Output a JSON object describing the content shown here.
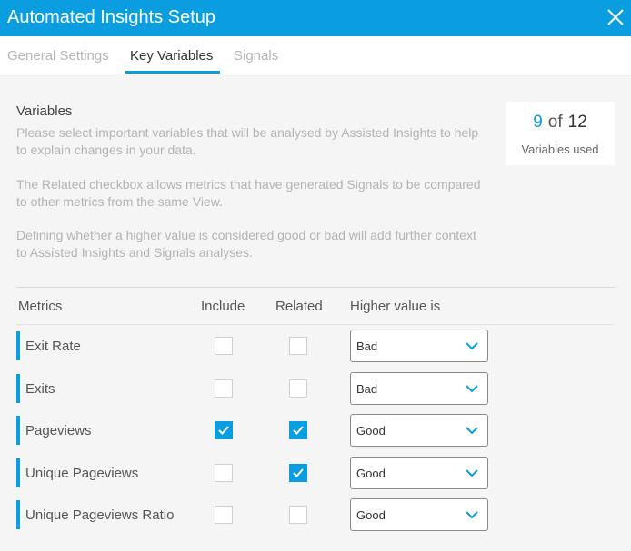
{
  "window": {
    "title": "Automated Insights Setup"
  },
  "tabs": [
    {
      "label": "General Settings",
      "active": false
    },
    {
      "label": "Key Variables",
      "active": true
    },
    {
      "label": "Signals",
      "active": false
    }
  ],
  "variables": {
    "heading": "Variables",
    "para1": "Please select important variables that will be analysed by Assisted Insights to help to explain changes in your data.",
    "para2": "The Related checkbox allows metrics that have generated Signals to be compared to other metrics from the same View.",
    "para3": "Defining whether a higher value is considered good or bad will add further context to Assisted Insights and Signals analyses."
  },
  "counter": {
    "used": "9",
    "of": "of",
    "total": "12",
    "label": "Variables used"
  },
  "table": {
    "headers": {
      "metrics": "Metrics",
      "include": "Include",
      "related": "Related",
      "higher": "Higher value is"
    },
    "rows": [
      {
        "metric": "Exit Rate",
        "include": false,
        "related": false,
        "higher": "Bad"
      },
      {
        "metric": "Exits",
        "include": false,
        "related": false,
        "higher": "Bad"
      },
      {
        "metric": "Pageviews",
        "include": true,
        "related": true,
        "higher": "Good"
      },
      {
        "metric": "Unique Pageviews",
        "include": false,
        "related": true,
        "higher": "Good"
      },
      {
        "metric": "Unique Pageviews Ratio",
        "include": false,
        "related": false,
        "higher": "Good"
      }
    ]
  },
  "colors": {
    "accent": "#0a9de0"
  },
  "icons": {
    "close": "close-icon",
    "check": "checkmark-icon",
    "dropdown": "chevron-down-icon"
  }
}
